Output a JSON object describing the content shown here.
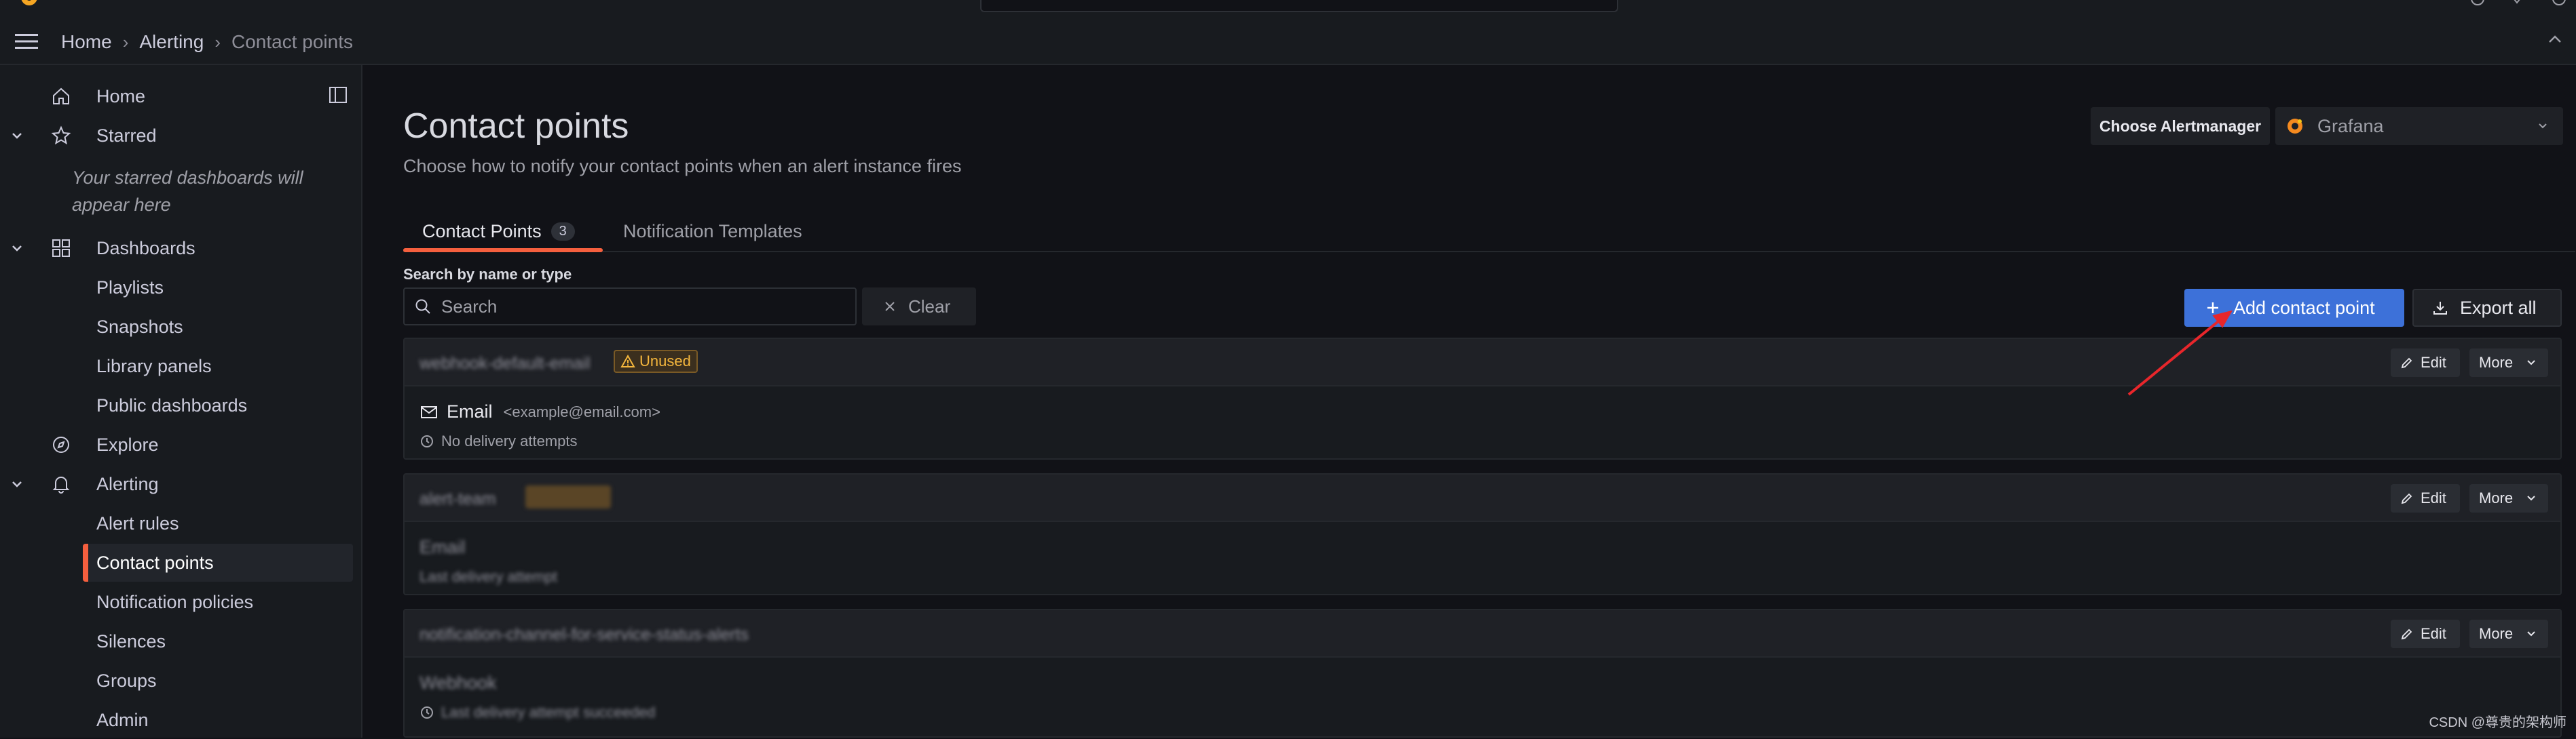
{
  "breadcrumb": {
    "home": "Home",
    "alerting": "Alerting",
    "current": "Contact points"
  },
  "sidebar": {
    "home": "Home",
    "starred": "Starred",
    "starred_empty": "Your starred dashboards will appear here",
    "dashboards": "Dashboards",
    "playlists": "Playlists",
    "snapshots": "Snapshots",
    "library_panels": "Library panels",
    "public_dashboards": "Public dashboards",
    "explore": "Explore",
    "alerting": "Alerting",
    "alert_rules": "Alert rules",
    "contact_points": "Contact points",
    "notification_policies": "Notification policies",
    "silences": "Silences",
    "groups": "Groups",
    "admin": "Admin"
  },
  "page": {
    "title": "Contact points",
    "subtitle": "Choose how to notify your contact points when an alert instance fires",
    "alertmanager_label": "Choose Alertmanager",
    "alertmanager_value": "Grafana"
  },
  "tabs": [
    {
      "label": "Contact Points",
      "count": "3"
    },
    {
      "label": "Notification Templates"
    }
  ],
  "search": {
    "label": "Search by name or type",
    "placeholder": "Search",
    "clear": "Clear"
  },
  "actions": {
    "add": "Add contact point",
    "export": "Export all"
  },
  "contact_points": [
    {
      "name": "webhook-default-email",
      "badge": "Unused",
      "integration": "Email",
      "address": "<example@email.com>",
      "status": "No delivery attempts"
    },
    {
      "name": "alert-team",
      "badge": "",
      "integration": "Email",
      "address": "",
      "status": "Last delivery attempt"
    },
    {
      "name": "notification-channel-for-service-status-alerts",
      "badge": "",
      "integration": "Webhook",
      "address": "",
      "status": "Last delivery attempt succeeded"
    }
  ],
  "buttons": {
    "edit": "Edit",
    "more": "More"
  },
  "watermark": "CSDN @尊贵的架构师",
  "colors": {
    "accent": "#f55f3e",
    "primary": "#3d71d9",
    "warning": "#f5b73d",
    "background": "#111217"
  },
  "icons": [
    "menu-icon",
    "home-icon",
    "star-icon",
    "dashboards-icon",
    "compass-icon",
    "bell-icon",
    "search-icon",
    "close-icon",
    "plus-icon",
    "download-icon",
    "pen-icon",
    "warning-icon",
    "mail-icon",
    "clock-icon",
    "grafana-icon"
  ]
}
